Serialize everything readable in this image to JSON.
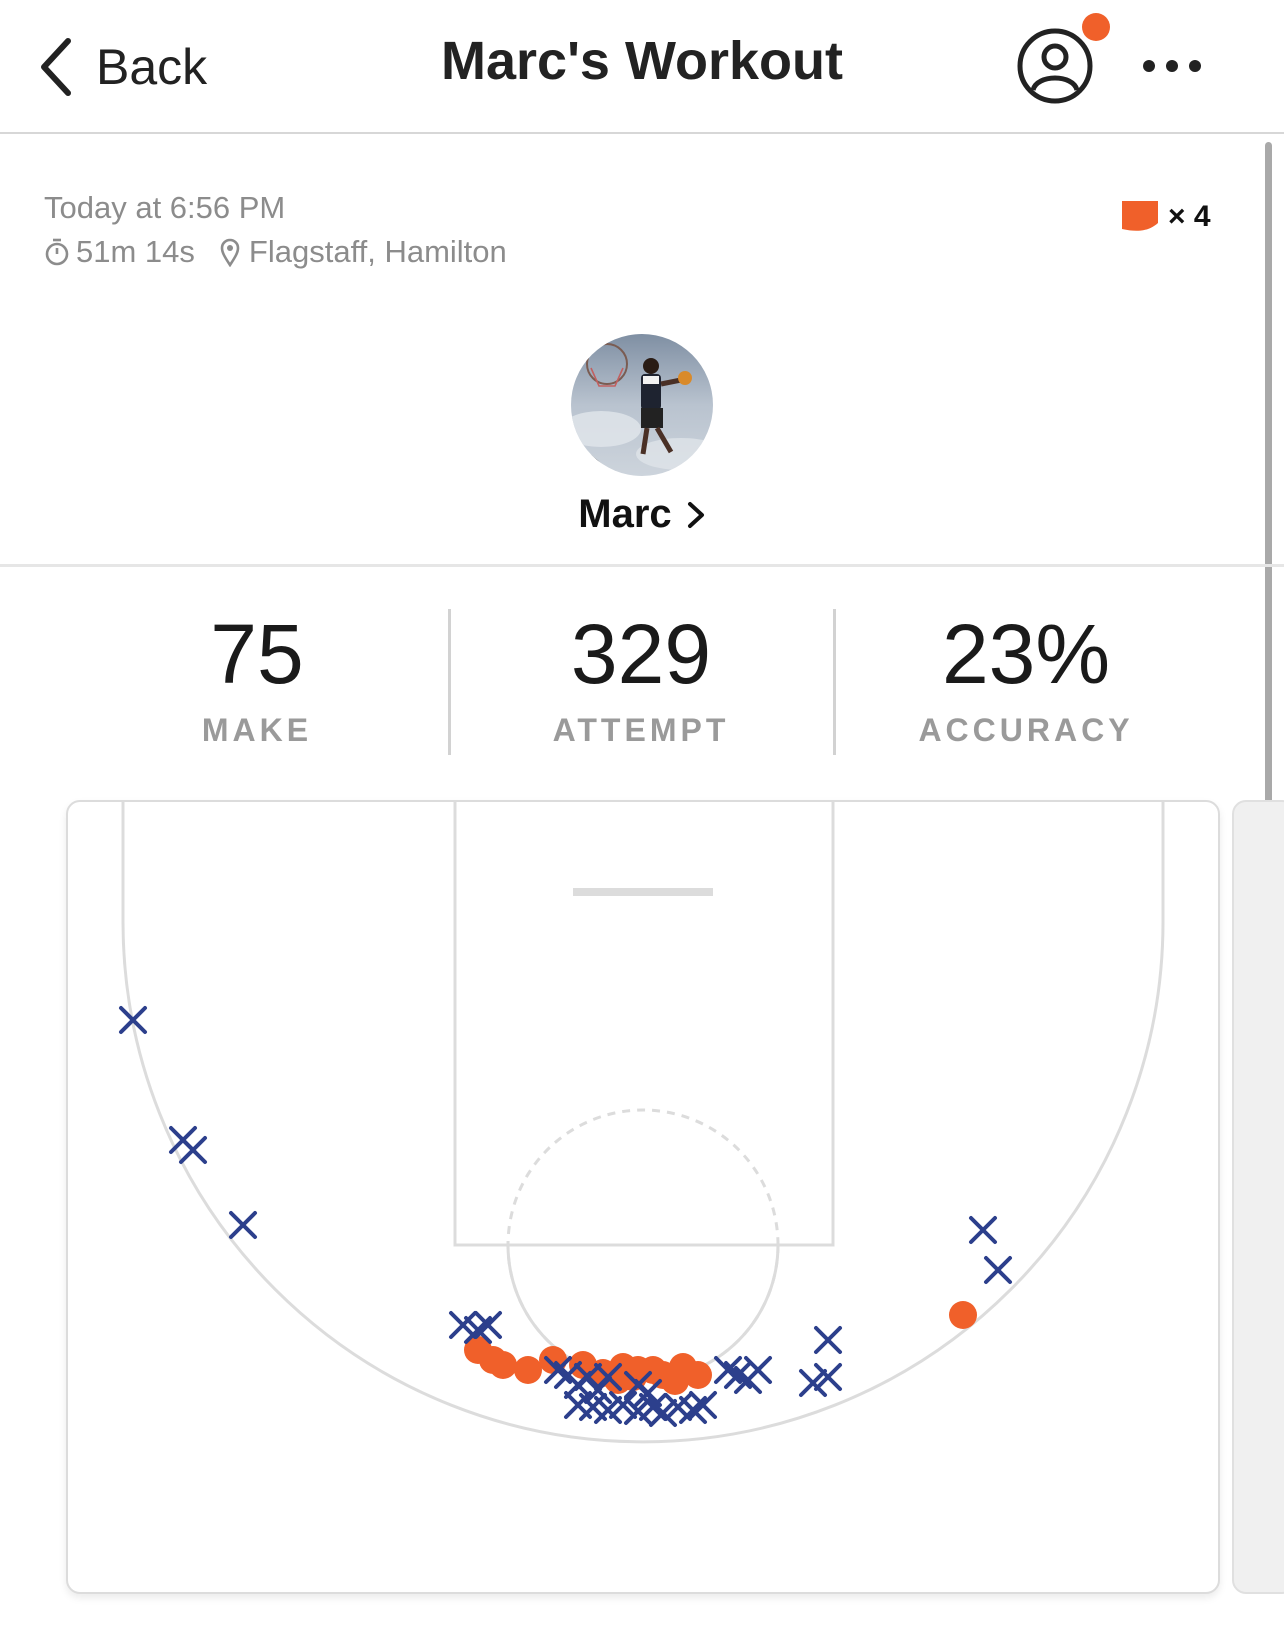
{
  "header": {
    "back_label": "Back",
    "title": "Marc's Workout",
    "profile_has_notification": true
  },
  "session": {
    "date": "Today at 6:56 PM",
    "duration": "51m 14s",
    "location": "Flagstaff, Hamilton",
    "badge_count": "× 4"
  },
  "player": {
    "name": "Marc"
  },
  "stats": [
    {
      "value": "75",
      "label": "MAKE"
    },
    {
      "value": "329",
      "label": "ATTEMPT"
    },
    {
      "value": "23%",
      "label": "ACCURACY"
    }
  ],
  "colors": {
    "accent": "#f0602a",
    "miss": "#2c3f8c",
    "court_line": "#dcdcdc"
  },
  "shot_chart": {
    "makes": [
      [
        -165,
        205
      ],
      [
        -140,
        220
      ],
      [
        -115,
        225
      ],
      [
        -90,
        215
      ],
      [
        -60,
        220
      ],
      [
        -40,
        228
      ],
      [
        -20,
        222
      ],
      [
        -10,
        232
      ],
      [
        10,
        225
      ],
      [
        20,
        230
      ],
      [
        40,
        222
      ],
      [
        55,
        230
      ],
      [
        -150,
        215
      ],
      [
        -25,
        235
      ],
      [
        -5,
        225
      ],
      [
        32,
        236
      ],
      [
        320,
        170
      ]
    ],
    "misses": [
      [
        -510,
        -125
      ],
      [
        -460,
        -5
      ],
      [
        -450,
        5
      ],
      [
        -400,
        80
      ],
      [
        -180,
        180
      ],
      [
        -165,
        185
      ],
      [
        -155,
        180
      ],
      [
        -85,
        225
      ],
      [
        -75,
        230
      ],
      [
        -65,
        240
      ],
      [
        -55,
        232
      ],
      [
        -45,
        245
      ],
      [
        -35,
        232
      ],
      [
        -5,
        240
      ],
      [
        5,
        248
      ],
      [
        85,
        225
      ],
      [
        95,
        230
      ],
      [
        105,
        235
      ],
      [
        115,
        225
      ],
      [
        -65,
        260
      ],
      [
        -50,
        262
      ],
      [
        -35,
        265
      ],
      [
        -20,
        260
      ],
      [
        -5,
        266
      ],
      [
        10,
        262
      ],
      [
        20,
        268
      ],
      [
        35,
        262
      ],
      [
        50,
        265
      ],
      [
        60,
        260
      ],
      [
        185,
        195
      ],
      [
        185,
        232
      ],
      [
        170,
        238
      ],
      [
        340,
        85
      ],
      [
        355,
        125
      ]
    ]
  }
}
